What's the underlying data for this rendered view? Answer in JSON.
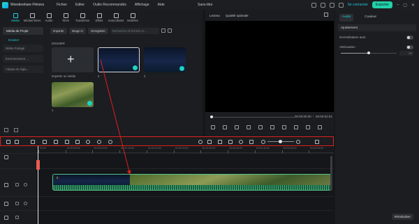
{
  "titlebar": {
    "app_name": "Wondershare Filmora",
    "menu": [
      "Fichier",
      "Editer",
      "Outils Recommandés",
      "Affichage",
      "Aide"
    ],
    "doc_title": "Sans-titre",
    "login": "Se connecter",
    "export": "Exporter"
  },
  "media_tabs": [
    {
      "label": "Média",
      "icon": "media-icon",
      "active": true
    },
    {
      "label": "Médias libres",
      "icon": "stock-media-icon"
    },
    {
      "label": "Audio",
      "icon": "music-note-icon"
    },
    {
      "label": "Titres",
      "icon": "text-icon"
    },
    {
      "label": "Transitions",
      "icon": "transitions-icon"
    },
    {
      "label": "Effets",
      "icon": "effects-icon"
    },
    {
      "label": "Autocollants",
      "icon": "stickers-icon"
    },
    {
      "label": "Modèles",
      "icon": "templates-icon"
    }
  ],
  "media_sidebar": {
    "project_media": "Média de Projet",
    "folder_head": "Dossier",
    "items": [
      "Média Partagé",
      "Environnement ...",
      "Calque de régla..."
    ]
  },
  "media_toolbar": {
    "import": "Importer",
    "image_ia": "Image IA",
    "record": "Enregistrer",
    "search_placeholder": "Recherche de fichiers m..."
  },
  "media_grid": {
    "folder_label": "DOSSIER",
    "import_label": "Importer un média",
    "clip1_label": "2",
    "clip2_label": "2",
    "clip3_label": "1"
  },
  "preview": {
    "player_label": "Lecteur",
    "quality": "Qualité optimale",
    "time_current": "00:00:00:00",
    "time_total": "00:00:52:04"
  },
  "right_panel": {
    "tab_audio": "Audio",
    "tab_color": "Couleur",
    "section": "Ajustement",
    "normalisation": "Normalisation auto",
    "attenuation": "Atténuation",
    "attenuation_value": "50",
    "attenuation_level_pct": 50,
    "reset": "Réinitialiser"
  },
  "timeline": {
    "ruler_labels": [
      "00:00",
      "00:00:05:00",
      "00:00:10:00",
      "00:00:15:00",
      "00:00:20:00",
      "00:00:25:00",
      "00:00:30:00",
      "00:00:35:00",
      "00:00:40:00",
      "00:00:45:00",
      "00:00:50:00"
    ],
    "clip_badge": "2"
  },
  "colors": {
    "accent": "#1fd3d9",
    "export_button": "#21d1a9",
    "highlight_border": "#e01e1e",
    "clip_green": "#2a7d55",
    "playhead": "#ea5b53"
  }
}
